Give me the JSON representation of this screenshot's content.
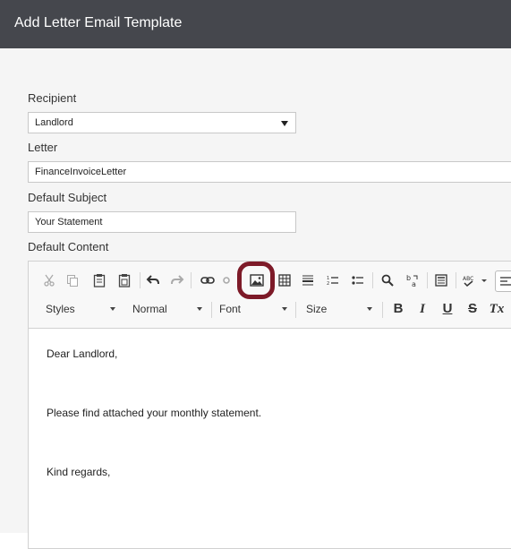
{
  "dialog": {
    "title": "Add Letter Email Template"
  },
  "form": {
    "recipient_label": "Recipient",
    "recipient_value": "Landlord",
    "letter_label": "Letter",
    "letter_value": "FinanceInvoiceLetter",
    "subject_label": "Default Subject",
    "subject_value": "Your Statement",
    "content_label": "Default Content"
  },
  "editor": {
    "toolbar_icons": [
      "cut-icon",
      "copy-icon",
      "paste-icon",
      "paste-from-word-icon",
      "undo-icon",
      "redo-icon",
      "link-icon",
      "unlink-icon",
      "image-icon",
      "table-icon",
      "horizontal-line-icon",
      "numbered-list-icon",
      "bulleted-list-icon",
      "find-icon",
      "replace-icon",
      "templates-icon",
      "spellcheck-icon"
    ],
    "styles_combo": "Styles",
    "format_combo": "Normal",
    "font_combo": "Font",
    "size_combo": "Size",
    "bold": "B",
    "italic": "I",
    "underline": "U",
    "strike": "S",
    "clear_format": "Tx",
    "content_lines": [
      "Dear Landlord,",
      "Please find attached your monthly statement.",
      "Kind regards,"
    ]
  },
  "colors": {
    "titlebar": "#45474d",
    "highlight": "#7d1a28"
  }
}
